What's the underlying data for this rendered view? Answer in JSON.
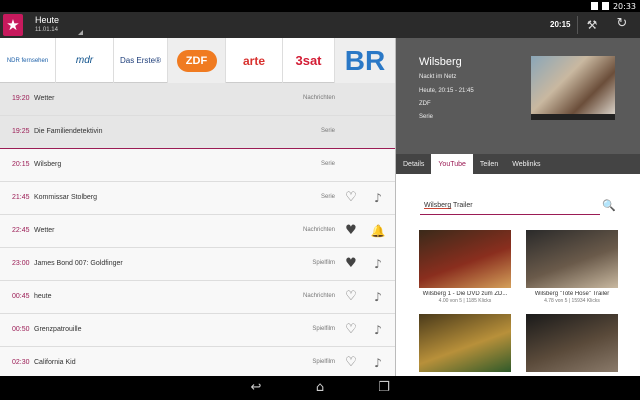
{
  "status_bar": {
    "time": "20:33"
  },
  "action_bar": {
    "day": "Heute",
    "date": "11.01.14",
    "current_time": "20:15"
  },
  "channels": [
    {
      "name": "NDR fernsehen"
    },
    {
      "name": "mdr"
    },
    {
      "name": "Das Erste®"
    },
    {
      "name": "ZDF"
    },
    {
      "name": "arte"
    },
    {
      "name": "3sat"
    },
    {
      "name": "BR"
    }
  ],
  "programs": [
    {
      "time": "19:20",
      "title": "Wetter",
      "genre": "Nachrichten",
      "favorite": false,
      "reminder": false,
      "icons": false,
      "grey": true
    },
    {
      "time": "19:25",
      "title": "Die Familiendetektivin",
      "genre": "Serie",
      "favorite": false,
      "reminder": false,
      "icons": false,
      "grey": true,
      "current": true
    },
    {
      "time": "20:15",
      "title": "Wilsberg",
      "genre": "Serie",
      "favorite": false,
      "reminder": false,
      "icons": false,
      "grey": false
    },
    {
      "time": "21:45",
      "title": "Kommissar Stolberg",
      "genre": "Serie",
      "favorite": false,
      "reminder": false,
      "icons": true,
      "grey": false
    },
    {
      "time": "22:45",
      "title": "Wetter",
      "genre": "Nachrichten",
      "favorite": true,
      "reminder": true,
      "icons": true,
      "grey": false
    },
    {
      "time": "23:00",
      "title": "James Bond 007: Goldfinger",
      "genre": "Spielfilm",
      "favorite": true,
      "reminder": false,
      "icons": true,
      "grey": false
    },
    {
      "time": "00:45",
      "title": "heute",
      "genre": "Nachrichten",
      "favorite": false,
      "reminder": false,
      "icons": true,
      "grey": false
    },
    {
      "time": "00:50",
      "title": "Grenzpatrouille",
      "genre": "Spielfilm",
      "favorite": false,
      "reminder": false,
      "icons": true,
      "grey": false
    },
    {
      "time": "02:30",
      "title": "California Kid",
      "genre": "Spielfilm",
      "favorite": false,
      "reminder": false,
      "icons": true,
      "grey": false
    }
  ],
  "details": {
    "title": "Wilsberg",
    "subtitle": "Nackt im Netz",
    "time": "Heute, 20:15 - 21:45",
    "channel": "ZDF",
    "genre": "Serie",
    "tabs": [
      {
        "label": "Details",
        "active": false
      },
      {
        "label": "YouTube",
        "active": true
      },
      {
        "label": "Teilen",
        "active": false
      },
      {
        "label": "Weblinks",
        "active": false
      }
    ],
    "search": {
      "query_word": "Wilsberg",
      "query_rest": " Trailer"
    },
    "videos": [
      {
        "title": "Wilsberg 1 - Die DVD zum ZD...",
        "meta": "4.00 von 5 | 1185 Klicks",
        "colors": [
          "#3a2a1a",
          "#8a2e1e",
          "#d4a05a"
        ]
      },
      {
        "title": "Wilsberg \"Tote Hose\" Trailer",
        "meta": "4.78 von 5 | 15934 Klicks",
        "colors": [
          "#2a2a2a",
          "#6a5a4a",
          "#c8b8a0"
        ]
      },
      {
        "title": "",
        "meta": "",
        "colors": [
          "#4a3a1a",
          "#b8903a",
          "#2f5a2a"
        ]
      },
      {
        "title": "",
        "meta": "",
        "colors": [
          "#1a1a1a",
          "#5a4a3a",
          "#8a7a6a"
        ]
      }
    ]
  },
  "colors": {
    "accent": "#9b1c55",
    "logo": "#c71a5d",
    "actionbar": "#2b2b2b"
  }
}
